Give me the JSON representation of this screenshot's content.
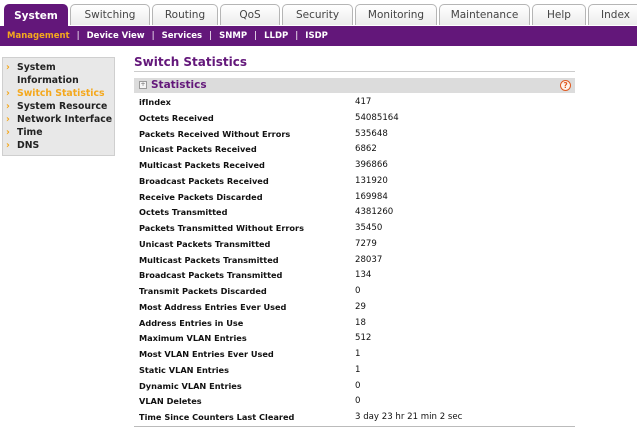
{
  "top_tabs": [
    {
      "label": "System",
      "width": 64,
      "active": true
    },
    {
      "label": "Switching",
      "width": 80,
      "active": false
    },
    {
      "label": "Routing",
      "width": 66,
      "active": false
    },
    {
      "label": "QoS",
      "width": 60,
      "active": false
    },
    {
      "label": "Security",
      "width": 71,
      "active": false
    },
    {
      "label": "Monitoring",
      "width": 82,
      "active": false
    },
    {
      "label": "Maintenance",
      "width": 91,
      "active": false
    },
    {
      "label": "Help",
      "width": 54,
      "active": false
    },
    {
      "label": "Index",
      "width": 55,
      "active": false
    }
  ],
  "sub_nav": [
    {
      "label": "Management",
      "active": true
    },
    {
      "label": "Device View",
      "active": false
    },
    {
      "label": "Services",
      "active": false
    },
    {
      "label": "SNMP",
      "active": false
    },
    {
      "label": "LLDP",
      "active": false
    },
    {
      "label": "ISDP",
      "active": false
    }
  ],
  "sidebar": [
    {
      "label": "System Information",
      "lines": [
        "System",
        "Information"
      ],
      "active": false
    },
    {
      "label": "Switch Statistics",
      "lines": [
        "Switch Statistics"
      ],
      "active": true
    },
    {
      "label": "System Resource",
      "lines": [
        "System Resource"
      ],
      "active": false
    },
    {
      "label": "Network Interface",
      "lines": [
        "Network Interface"
      ],
      "active": false
    },
    {
      "label": "Time",
      "lines": [
        "Time"
      ],
      "active": false
    },
    {
      "label": "DNS",
      "lines": [
        "DNS"
      ],
      "active": false
    }
  ],
  "page_title": "Switch Statistics",
  "section_title": "Statistics",
  "help_glyph": "?",
  "bullet_glyph": "›",
  "statistics": [
    {
      "name": "ifIndex",
      "value": "417"
    },
    {
      "name": "Octets Received",
      "value": "54085164"
    },
    {
      "name": "Packets Received Without Errors",
      "value": "535648"
    },
    {
      "name": "Unicast Packets Received",
      "value": "6862"
    },
    {
      "name": "Multicast Packets Received",
      "value": "396866"
    },
    {
      "name": "Broadcast Packets Received",
      "value": "131920"
    },
    {
      "name": "Receive Packets Discarded",
      "value": "169984"
    },
    {
      "name": "Octets Transmitted",
      "value": "4381260"
    },
    {
      "name": "Packets Transmitted Without Errors",
      "value": "35450"
    },
    {
      "name": "Unicast Packets Transmitted",
      "value": "7279"
    },
    {
      "name": "Multicast Packets Transmitted",
      "value": "28037"
    },
    {
      "name": "Broadcast Packets Transmitted",
      "value": "134"
    },
    {
      "name": "Transmit Packets Discarded",
      "value": "0"
    },
    {
      "name": "Most Address Entries Ever Used",
      "value": "29"
    },
    {
      "name": "Address Entries in Use",
      "value": "18"
    },
    {
      "name": "Maximum VLAN Entries",
      "value": "512"
    },
    {
      "name": "Most VLAN Entries Ever Used",
      "value": "1"
    },
    {
      "name": "Static VLAN Entries",
      "value": "1"
    },
    {
      "name": "Dynamic VLAN Entries",
      "value": "0"
    },
    {
      "name": "VLAN Deletes",
      "value": "0"
    },
    {
      "name": "Time Since Counters Last Cleared",
      "value": "3 day 23 hr 21 min 2 sec"
    }
  ]
}
